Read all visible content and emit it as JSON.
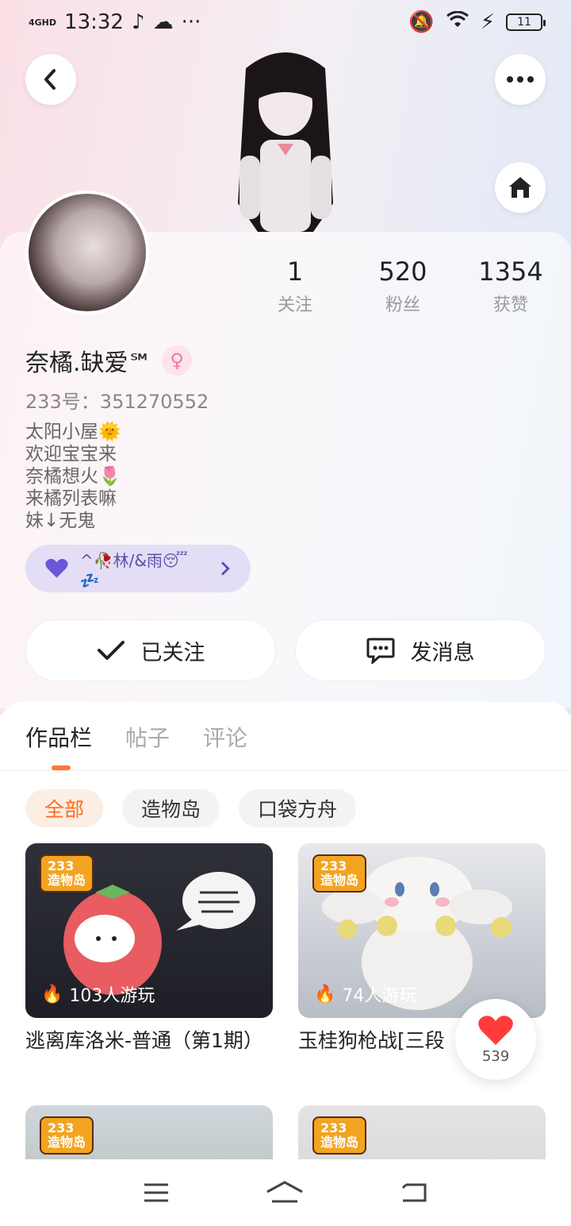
{
  "status": {
    "network": "4GHD",
    "time": "13:32",
    "battery": "11"
  },
  "profile": {
    "name": "奈橘.缺爱℠",
    "gender_icon": "female-symbol",
    "uid": "233号：351270552",
    "bio": [
      "太阳小屋🌞",
      "欢迎宝宝来",
      "奈橘想火🌷",
      "来橘列表嘛",
      "妹↓无鬼"
    ],
    "friend_tag": "^🥀林/&雨😴💤",
    "stats": [
      {
        "num": "1",
        "label": "关注"
      },
      {
        "num": "520",
        "label": "粉丝"
      },
      {
        "num": "1354",
        "label": "获赞"
      }
    ]
  },
  "actions": {
    "follow_label": "已关注",
    "message_label": "发消息"
  },
  "tabs": [
    "作品栏",
    "帖子",
    "评论"
  ],
  "filters": [
    "全部",
    "造物岛",
    "口袋方舟"
  ],
  "games": [
    {
      "badge": "233\n造物岛",
      "plays": "103人游玩",
      "title": "逃离库洛米-普通（第1期）"
    },
    {
      "badge": "233\n造物岛",
      "plays": "74人游玩",
      "title": "玉桂狗枪战[三段"
    },
    {
      "badge": "233\n造物岛",
      "plays": "",
      "title": ""
    },
    {
      "badge": "233\n造物岛",
      "plays": "",
      "title": ""
    }
  ],
  "like": {
    "count": "539"
  },
  "colors": {
    "accent": "#ff7a2f",
    "friend_pill": "#e4ddf6",
    "like_heart": "#ff3b3b"
  }
}
